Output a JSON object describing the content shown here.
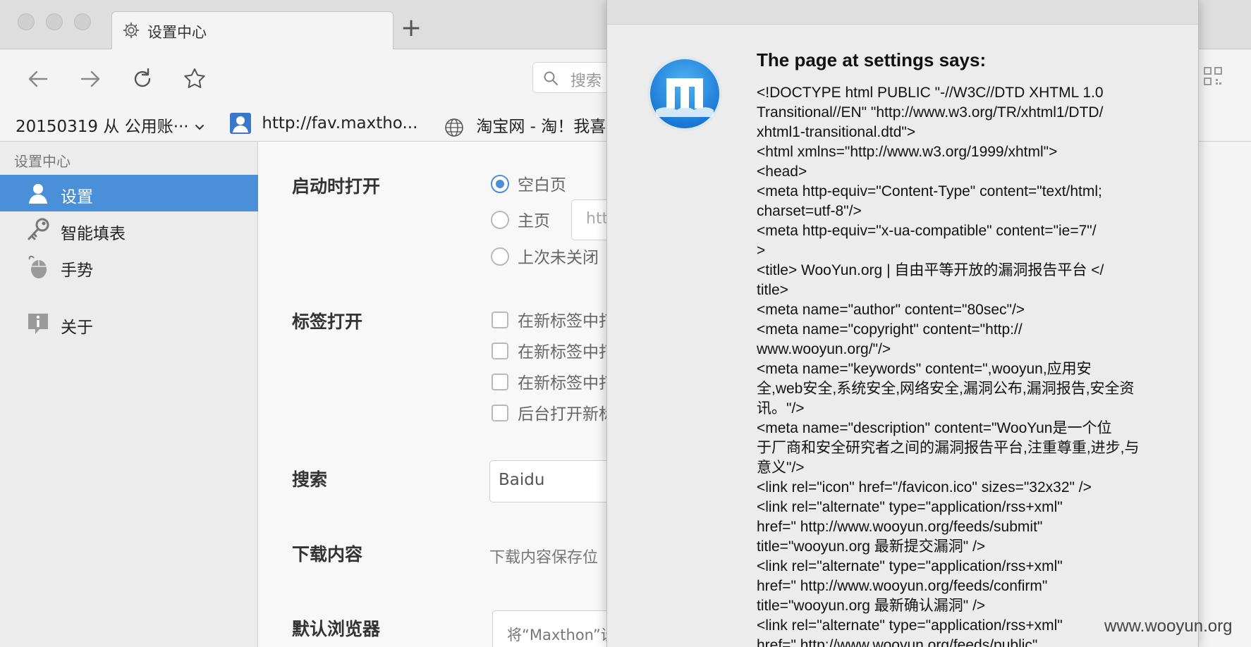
{
  "tab": {
    "title": "设置中心",
    "new_tab_symbol": "+",
    "icon": "gear-icon"
  },
  "toolbar": {
    "search_placeholder": "搜索\t"
  },
  "bookmarks": [
    {
      "label": "20150319 从 公用账··· ",
      "icon": "chevron-down-icon"
    },
    {
      "label": "http://fav.maxtho...",
      "icon": "user-icon"
    },
    {
      "label": "淘宝网 - 淘！我喜",
      "icon": "globe-icon"
    }
  ],
  "sidebar": {
    "heading": "设置中心",
    "items": [
      {
        "label": "设置",
        "icon": "user-icon",
        "active": true
      },
      {
        "label": "智能填表",
        "icon": "key-icon",
        "active": false
      },
      {
        "label": "手势",
        "icon": "mouse-icon",
        "active": false
      },
      {
        "label": "关于",
        "icon": "info-icon",
        "active": false
      }
    ]
  },
  "settings": {
    "startup": {
      "label": "启动时打开",
      "options": [
        "空白页",
        "主页",
        "上次未关闭"
      ],
      "selected": 0,
      "homepage_value": "htt"
    },
    "tabs": {
      "label": "标签打开",
      "options": [
        "在新标签中打",
        "在新标签中打",
        "在新标签中打",
        "后台打开新标"
      ]
    },
    "search": {
      "label": "搜索",
      "engine": "Baidu"
    },
    "download": {
      "label": "下载内容",
      "text": "下载内容保存位"
    },
    "default_browser": {
      "label": "默认浏览器",
      "button": "将“Maxthon”设"
    }
  },
  "dialog": {
    "title": "The page at settings says:",
    "icon": "maxthon-logo-icon",
    "lines": [
      "<!DOCTYPE html PUBLIC \"-//W3C//DTD XHTML 1.0",
      "Transitional//EN\" \"http://www.w3.org/TR/xhtml1/DTD/",
      "xhtml1-transitional.dtd\">",
      "<html xmlns=\"http://www.w3.org/1999/xhtml\">",
      "<head>",
      "<meta http-equiv=\"Content-Type\" content=\"text/html;",
      "charset=utf-8\"/>",
      "<meta http-equiv=\"x-ua-compatible\" content=\"ie=7\"/",
      ">",
      "<title> WooYun.org | 自由平等开放的漏洞报告平台 </",
      "title>",
      "<meta name=\"author\" content=\"80sec\"/>",
      "<meta name=\"copyright\" content=\"http://",
      "www.wooyun.org/\"/>",
      "<meta name=\"keywords\" content=\",wooyun,应用安",
      "全,web安全,系统安全,网络安全,漏洞公布,漏洞报告,安全资",
      "讯。\"/>",
      "<meta name=\"description\" content=\"WooYun是一个位",
      "于厂商和安全研究者之间的漏洞报告平台,注重尊重,进步,与",
      "意义\"/>",
      "<link rel=\"icon\" href=\"/favicon.ico\" sizes=\"32x32\" />",
      "<link rel=\"alternate\" type=\"application/rss+xml\"",
      "href=\" http://www.wooyun.org/feeds/submit\"",
      "title=\"wooyun.org 最新提交漏洞\" />",
      "<link rel=\"alternate\" type=\"application/rss+xml\"",
      "href=\" http://www.wooyun.org/feeds/confirm\"",
      "title=\"wooyun.org 最新确认漏洞\" />",
      "<link rel=\"alternate\" type=\"application/rss+xml\"",
      "href=\" http://www.wooyun.org/feeds/public\""
    ]
  },
  "watermark": "www.wooyun.org",
  "colors": {
    "accent": "#4a90d9",
    "sidebar_bg": "#ececec",
    "dialog_bg": "#ececec"
  }
}
